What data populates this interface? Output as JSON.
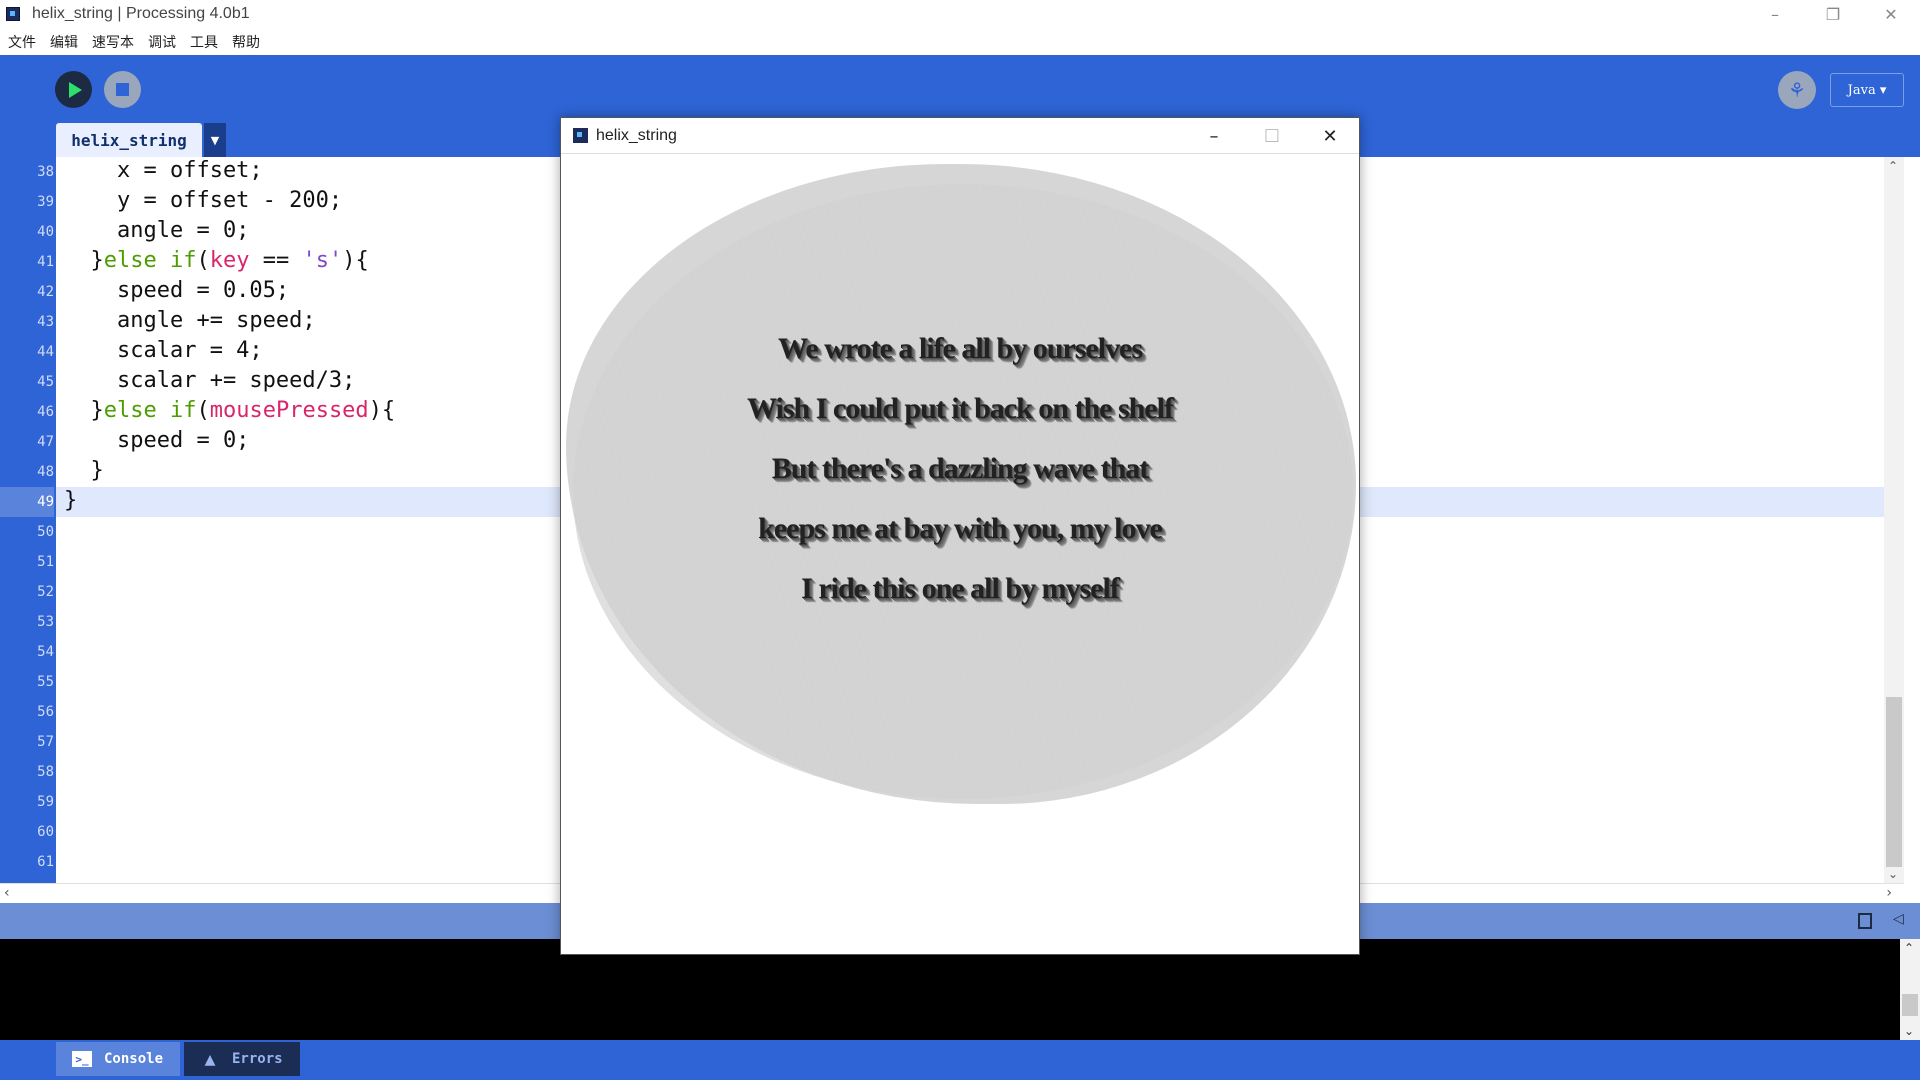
{
  "window": {
    "title": "helix_string | Processing 4.0b1",
    "controls": [
      "–",
      "❐",
      "✕"
    ]
  },
  "menu": [
    "文件",
    "编辑",
    "速写本",
    "调试",
    "工具",
    "帮助"
  ],
  "toolbar": {
    "mode_label": "Java ▾",
    "debug_icon": "debug-icon"
  },
  "tabs": [
    {
      "label": "helix_string"
    }
  ],
  "editor": {
    "lines": [
      {
        "n": "38",
        "code": "    x = offset;"
      },
      {
        "n": "39",
        "code": "    y = offset - 200;"
      },
      {
        "n": "40",
        "code": "    angle = 0;"
      },
      {
        "n": "41",
        "code": "  }else if(key == 's'){"
      },
      {
        "n": "42",
        "code": "    speed = 0.05;"
      },
      {
        "n": "43",
        "code": "    angle += speed;"
      },
      {
        "n": "44",
        "code": "    scalar = 4;"
      },
      {
        "n": "45",
        "code": "    scalar += speed/3;"
      },
      {
        "n": "46",
        "code": "  }else if(mousePressed){"
      },
      {
        "n": "47",
        "code": "    speed = 0;"
      },
      {
        "n": "48",
        "code": "  }"
      },
      {
        "n": "49",
        "code": "}"
      },
      {
        "n": "50",
        "code": ""
      },
      {
        "n": "51",
        "code": ""
      },
      {
        "n": "52",
        "code": ""
      },
      {
        "n": "53",
        "code": ""
      },
      {
        "n": "54",
        "code": ""
      },
      {
        "n": "55",
        "code": ""
      },
      {
        "n": "56",
        "code": ""
      },
      {
        "n": "57",
        "code": ""
      },
      {
        "n": "58",
        "code": ""
      },
      {
        "n": "59",
        "code": ""
      },
      {
        "n": "60",
        "code": ""
      },
      {
        "n": "61",
        "code": ""
      }
    ],
    "current_line": "49"
  },
  "bottom_tabs": {
    "console": "Console",
    "errors": "Errors"
  },
  "sketch": {
    "title": "helix_string",
    "lyrics": [
      "We wrote a life all by ourselves",
      "Wish I could put it back on the shelf",
      "But there's a dazzling wave that",
      "keeps me at bay with you, my love",
      "I ride this one all by myself"
    ]
  },
  "colors": {
    "accent": "#2e64d6",
    "console_bg": "#000000",
    "keyword": "#4d9d00",
    "variable": "#d9266b",
    "string": "#7c4bc8"
  }
}
